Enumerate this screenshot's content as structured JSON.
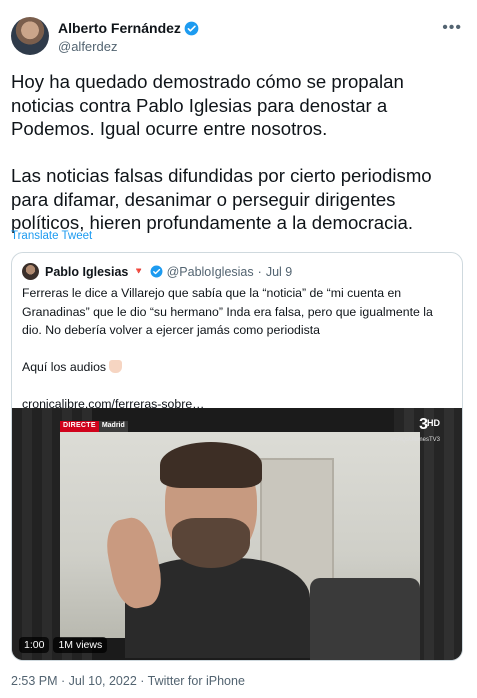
{
  "author": {
    "name": "Alberto Fernández",
    "handle": "@alferdez",
    "verified": true,
    "more_icon": "ellipsis-icon"
  },
  "tweet": {
    "text": "Hoy ha quedado demostrado cómo se propalan noticias contra Pablo Iglesias para denostar a Podemos. Igual ocurre entre nosotros.\n\nLas noticias falsas difundidas por cierto periodismo para difamar, desanimar o perseguir dirigentes políticos, hieren profundamente a la democracia.",
    "translate_label": "Translate Tweet",
    "footer": "2:53 PM · Jul 10, 2022 · Twitter for iPhone"
  },
  "quote": {
    "name": "Pablo Iglesias",
    "flag_glyph": "🔻",
    "handle": "@PabloIglesias",
    "separator": "·",
    "date": "Jul 9",
    "text": "Ferreras le dice a Villarejo que sabía que la “noticia” de “mi cuenta en Granadinas” que le dio “su hermano” Inda era falsa, pero que igualmente la dio. No debería volver a ejercer jamás como periodista\n\nAquí los audios",
    "link": "cronicalibre.com/ferreras-sobre…",
    "video": {
      "live_tag": "DIRECTE",
      "city": "Madrid",
      "channel_logo": "3",
      "channel_suffix": "HD",
      "hashtag": "#FAQsUltimesTV3",
      "duration": "1:00",
      "views": "1M views"
    }
  },
  "colors": {
    "accent": "#1d9bf0",
    "text": "#0f1419",
    "secondary": "#536471",
    "border": "#cfd9de"
  }
}
